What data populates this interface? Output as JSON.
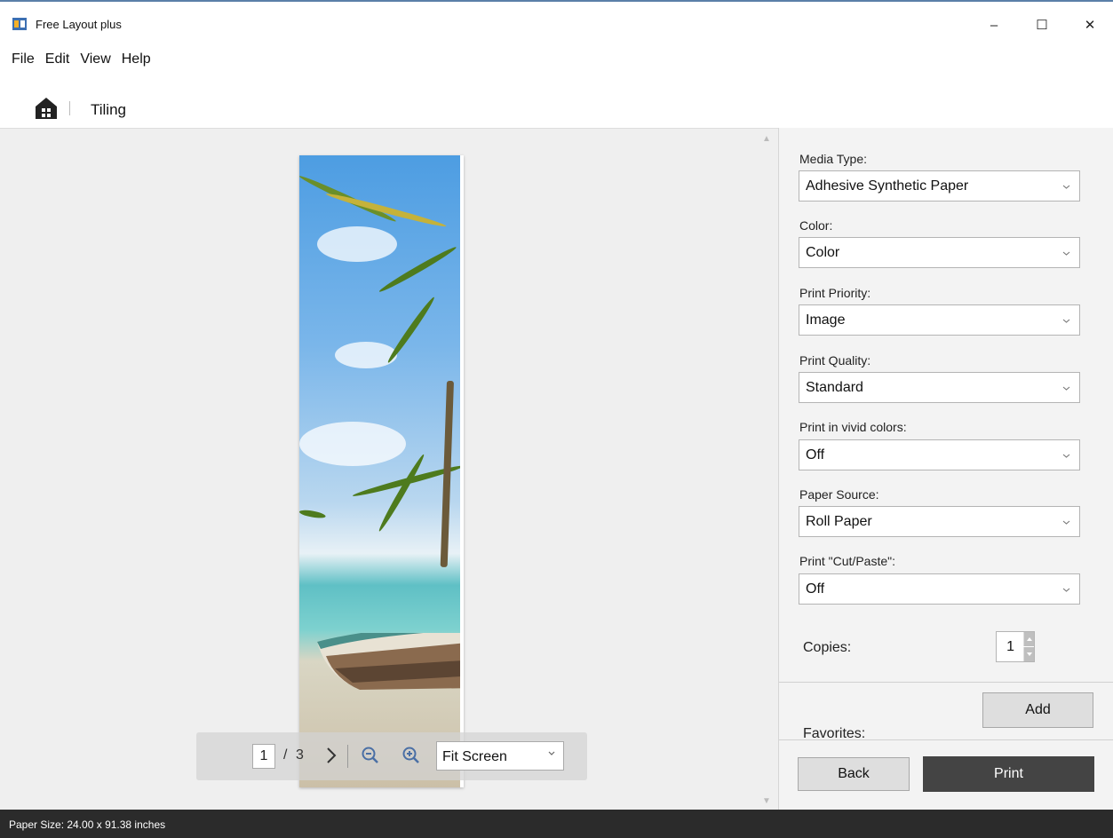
{
  "window": {
    "title": "Free Layout plus",
    "minimize_symbol": "–",
    "maximize_symbol": "☐",
    "close_symbol": "✕"
  },
  "menu": [
    "File",
    "Edit",
    "View",
    "Help"
  ],
  "breadcrumb": {
    "home_icon": "home-icon",
    "label": "Tiling"
  },
  "preview": {
    "current_page": "1",
    "separator": "/",
    "total_pages": "3",
    "zoom": "Fit Screen"
  },
  "settings": [
    {
      "label": "Media Type:",
      "value": "Adhesive Synthetic Paper"
    },
    {
      "label": "Color:",
      "value": "Color"
    },
    {
      "label": "Print Priority:",
      "value": "Image"
    },
    {
      "label": "Print Quality:",
      "value": "Standard"
    },
    {
      "label": "Print in vivid colors:",
      "value": "Off"
    },
    {
      "label": "Paper Source:",
      "value": "Roll Paper"
    },
    {
      "label": "Print \"Cut/Paste\":",
      "value": "Off"
    }
  ],
  "copies": {
    "label": "Copies:",
    "value": "1"
  },
  "favorites": {
    "label": "Favorites:",
    "add_label": "Add"
  },
  "actions": {
    "back_label": "Back",
    "print_label": "Print"
  },
  "status": {
    "paper_size": "Paper Size: 24.00 x 91.38 inches"
  },
  "colors": {
    "status_bar": "#2b2b2b",
    "print_button": "#444444",
    "panel_bg": "#f3f3f3",
    "preview_bg": "#efefef"
  }
}
